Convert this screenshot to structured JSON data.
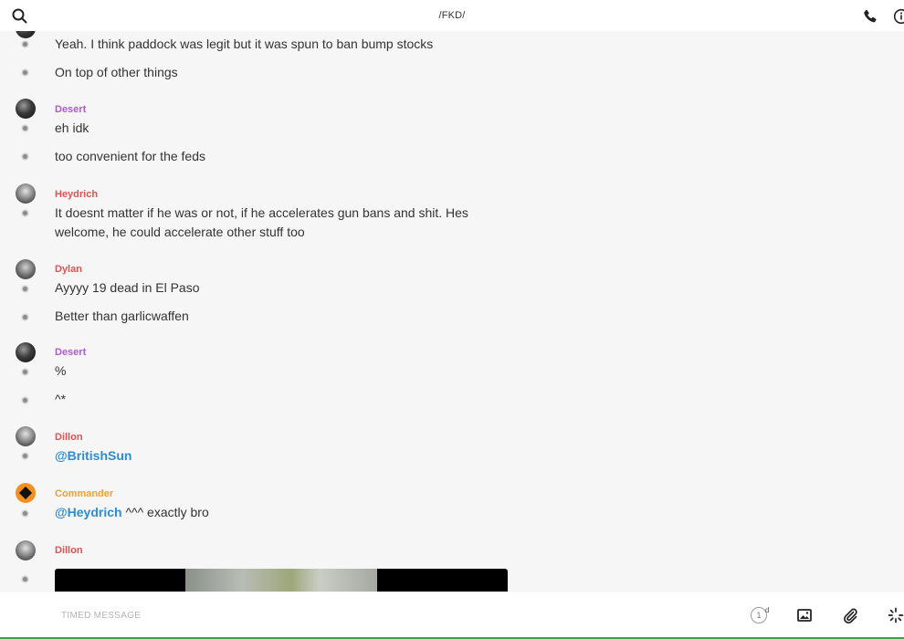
{
  "header": {
    "title": "/FKD/",
    "icons": {
      "search": "search-icon",
      "phone": "phone-icon",
      "info": "info-icon"
    }
  },
  "messages": [
    {
      "text": "Yeah. I think paddock was legit but it was spun to ban bump stocks"
    },
    {
      "text": "On top of other things"
    },
    {
      "author": "Desert",
      "author_color": "#b05ad3",
      "text": "eh idk"
    },
    {
      "text": "too convenient for the feds"
    },
    {
      "author": "Heydrich",
      "author_color": "#e05252",
      "text": "It doesnt matter if he was or not, if he accelerates gun bans and shit. Hes welcome, he could accelerate other stuff too"
    },
    {
      "author": "Dylan",
      "author_color": "#e05252",
      "text": "Ayyyy 19 dead in El Paso"
    },
    {
      "text": "Better than garlicwaffen"
    },
    {
      "author": "Desert",
      "author_color": "#b05ad3",
      "text": "%"
    },
    {
      "text": "^*"
    },
    {
      "author": "Dillon",
      "author_color": "#e05252",
      "mention": "@BritishSun",
      "text": ""
    },
    {
      "author": "Commander",
      "author_color": "#f0a030",
      "mention": "@Heydrich",
      "text": " ^^^ exactly bro"
    },
    {
      "author": "Dillon",
      "author_color": "#e05252",
      "attachment": "image"
    }
  ],
  "composer": {
    "placeholder": "TIMED MESSAGE",
    "timer_value": "1",
    "timer_unit": "d",
    "icons": {
      "image": "image-icon",
      "attach": "paperclip-icon",
      "effects": "sparkle-icon"
    }
  },
  "colors": {
    "mention": "#2d8cd3",
    "accent_green": "#3aa34a"
  }
}
